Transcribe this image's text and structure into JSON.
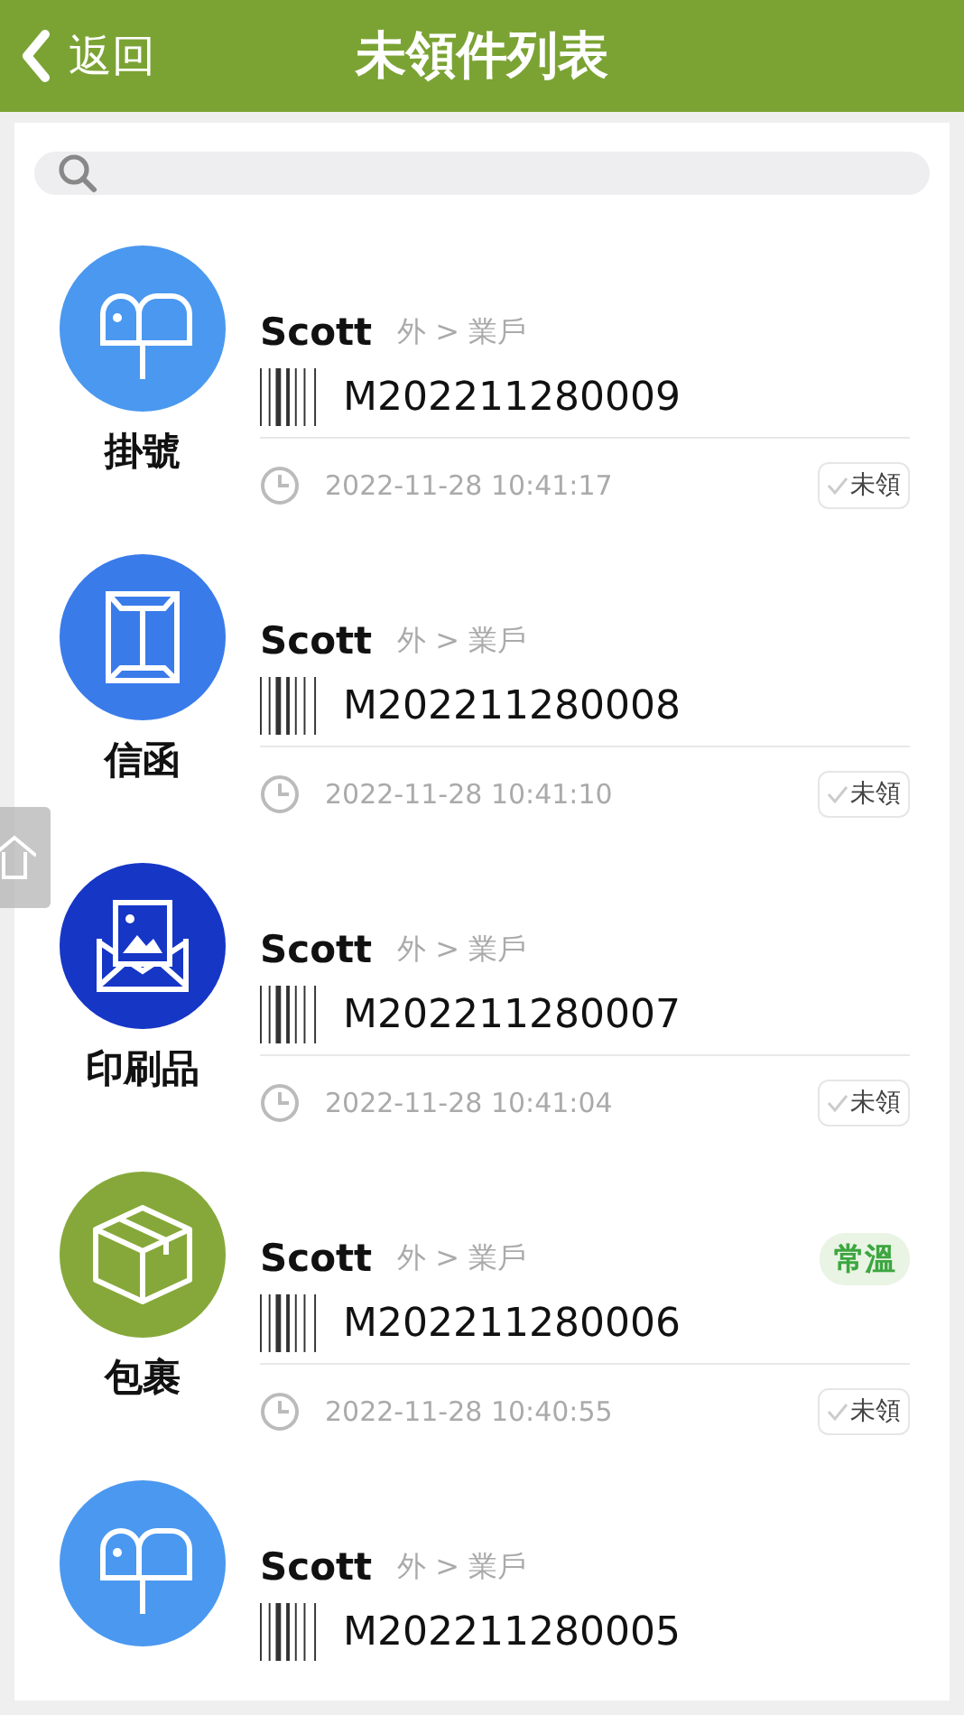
{
  "header": {
    "back": "返回",
    "title": "未領件列表"
  },
  "items": [
    {
      "kind": "mailbox",
      "color": "#4a98f0",
      "type": "掛號",
      "name": "Scott",
      "route": "外 > 業戶",
      "code": "M202211280009",
      "time": "2022-11-28 10:41:17",
      "status": "未領"
    },
    {
      "kind": "envelope",
      "color": "#3a7bea",
      "type": "信函",
      "name": "Scott",
      "route": "外 > 業戶",
      "code": "M202211280008",
      "time": "2022-11-28 10:41:10",
      "status": "未領"
    },
    {
      "kind": "print",
      "color": "#1636c6",
      "type": "印刷品",
      "name": "Scott",
      "route": "外 > 業戶",
      "code": "M202211280007",
      "time": "2022-11-28 10:41:04",
      "status": "未領"
    },
    {
      "kind": "parcel",
      "color": "#86a83a",
      "type": "包裹",
      "name": "Scott",
      "route": "外 > 業戶",
      "tag": "常溫",
      "code": "M202211280006",
      "time": "2022-11-28 10:40:55",
      "status": "未領"
    },
    {
      "kind": "mailbox",
      "color": "#4a98f0",
      "name": "Scott",
      "route": "外 > 業戶",
      "code": "M202211280005"
    }
  ]
}
